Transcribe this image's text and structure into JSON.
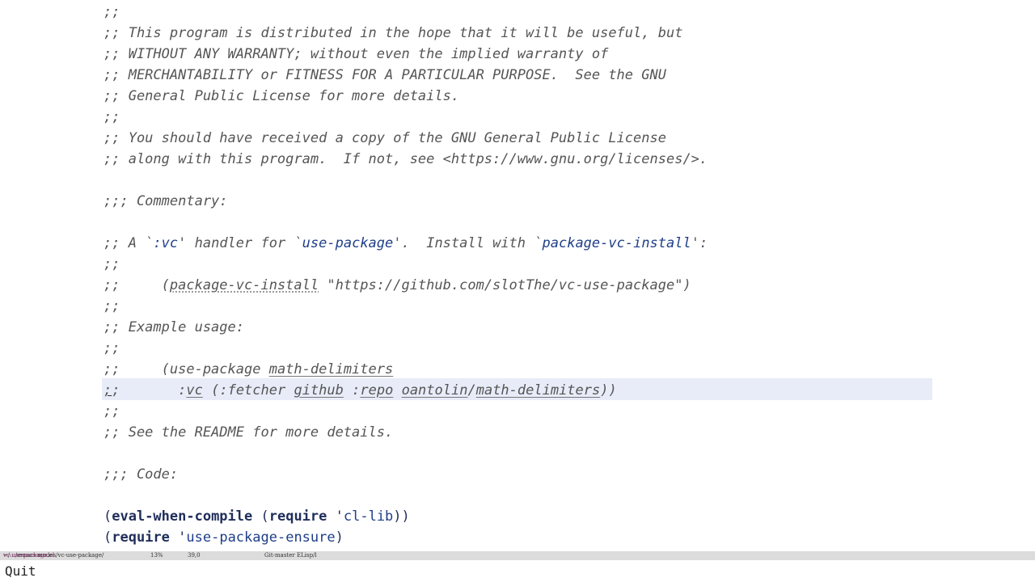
{
  "editor": {
    "lines": [
      ";;",
      ";; This program is distributed in the hope that it will be useful, but",
      ";; WITHOUT ANY WARRANTY; without even the implied warranty of",
      ";; MERCHANTABILITY or FITNESS FOR A PARTICULAR PURPOSE.  See the GNU",
      ";; General Public License for more details.",
      ";;",
      ";; You should have received a copy of the GNU General Public License",
      ";; along with this program.  If not, see <https://www.gnu.org/licenses/>.",
      ";;; Commentary:",
      ";;",
      ";;",
      ";; Example usage:",
      ";;",
      ";;",
      ";; See the README for more details.",
      ";;; Code:"
    ],
    "handler_line": {
      "p1": ";; A `",
      "t1": ":vc",
      "p2": "' handler for `",
      "t2": "use-package",
      "p3": "'.  Install with `",
      "t3": "package-vc-install",
      "p4": "':"
    },
    "install_line": {
      "p1": ";;     (",
      "t1": "package-vc-install",
      "p2": " \"https://github.com/slotThe/vc-use-package\")"
    },
    "usage_line1": {
      "p1": ";;     (use-package ",
      "t1": "math-delimiters"
    },
    "usage_line2": {
      "c1": ";",
      "c2": ";",
      "p1": "       :",
      "t1": "vc",
      "p2": " (:fetcher ",
      "t2": "github",
      "p3": " :",
      "t3": "repo",
      "p4": " ",
      "t4": "oantolin",
      "p5": "/",
      "t5": "math-delimiters",
      "p6": "))"
    },
    "code1": {
      "open": "(",
      "kw1": "eval-when-compile",
      "sp": " (",
      "kw2": "require",
      "q": " '",
      "sym": "cl-lib",
      "close": "))"
    },
    "code2": {
      "open": "(",
      "kw": "require",
      "q": " '",
      "sym": "use-package-ensure",
      "close": ")"
    }
  },
  "modeline": {
    "path_prefix": "~/.../emacs-modes/vc-use-package/",
    "file": "vc-use-package.el",
    "percent": "13%",
    "position": "39,0",
    "vc": "Git-master",
    "mode": "ELisp/l"
  },
  "minibuffer": {
    "message": "Quit"
  },
  "colors": {
    "background": "#ffffff",
    "comment": "#555555",
    "keyword": "#1f2d5a",
    "reference": "#1f3e88",
    "highlight_line": "#e8ecf8",
    "modeline_bg": "#dcdcdc",
    "modeline_file": "#7a1f5f"
  }
}
